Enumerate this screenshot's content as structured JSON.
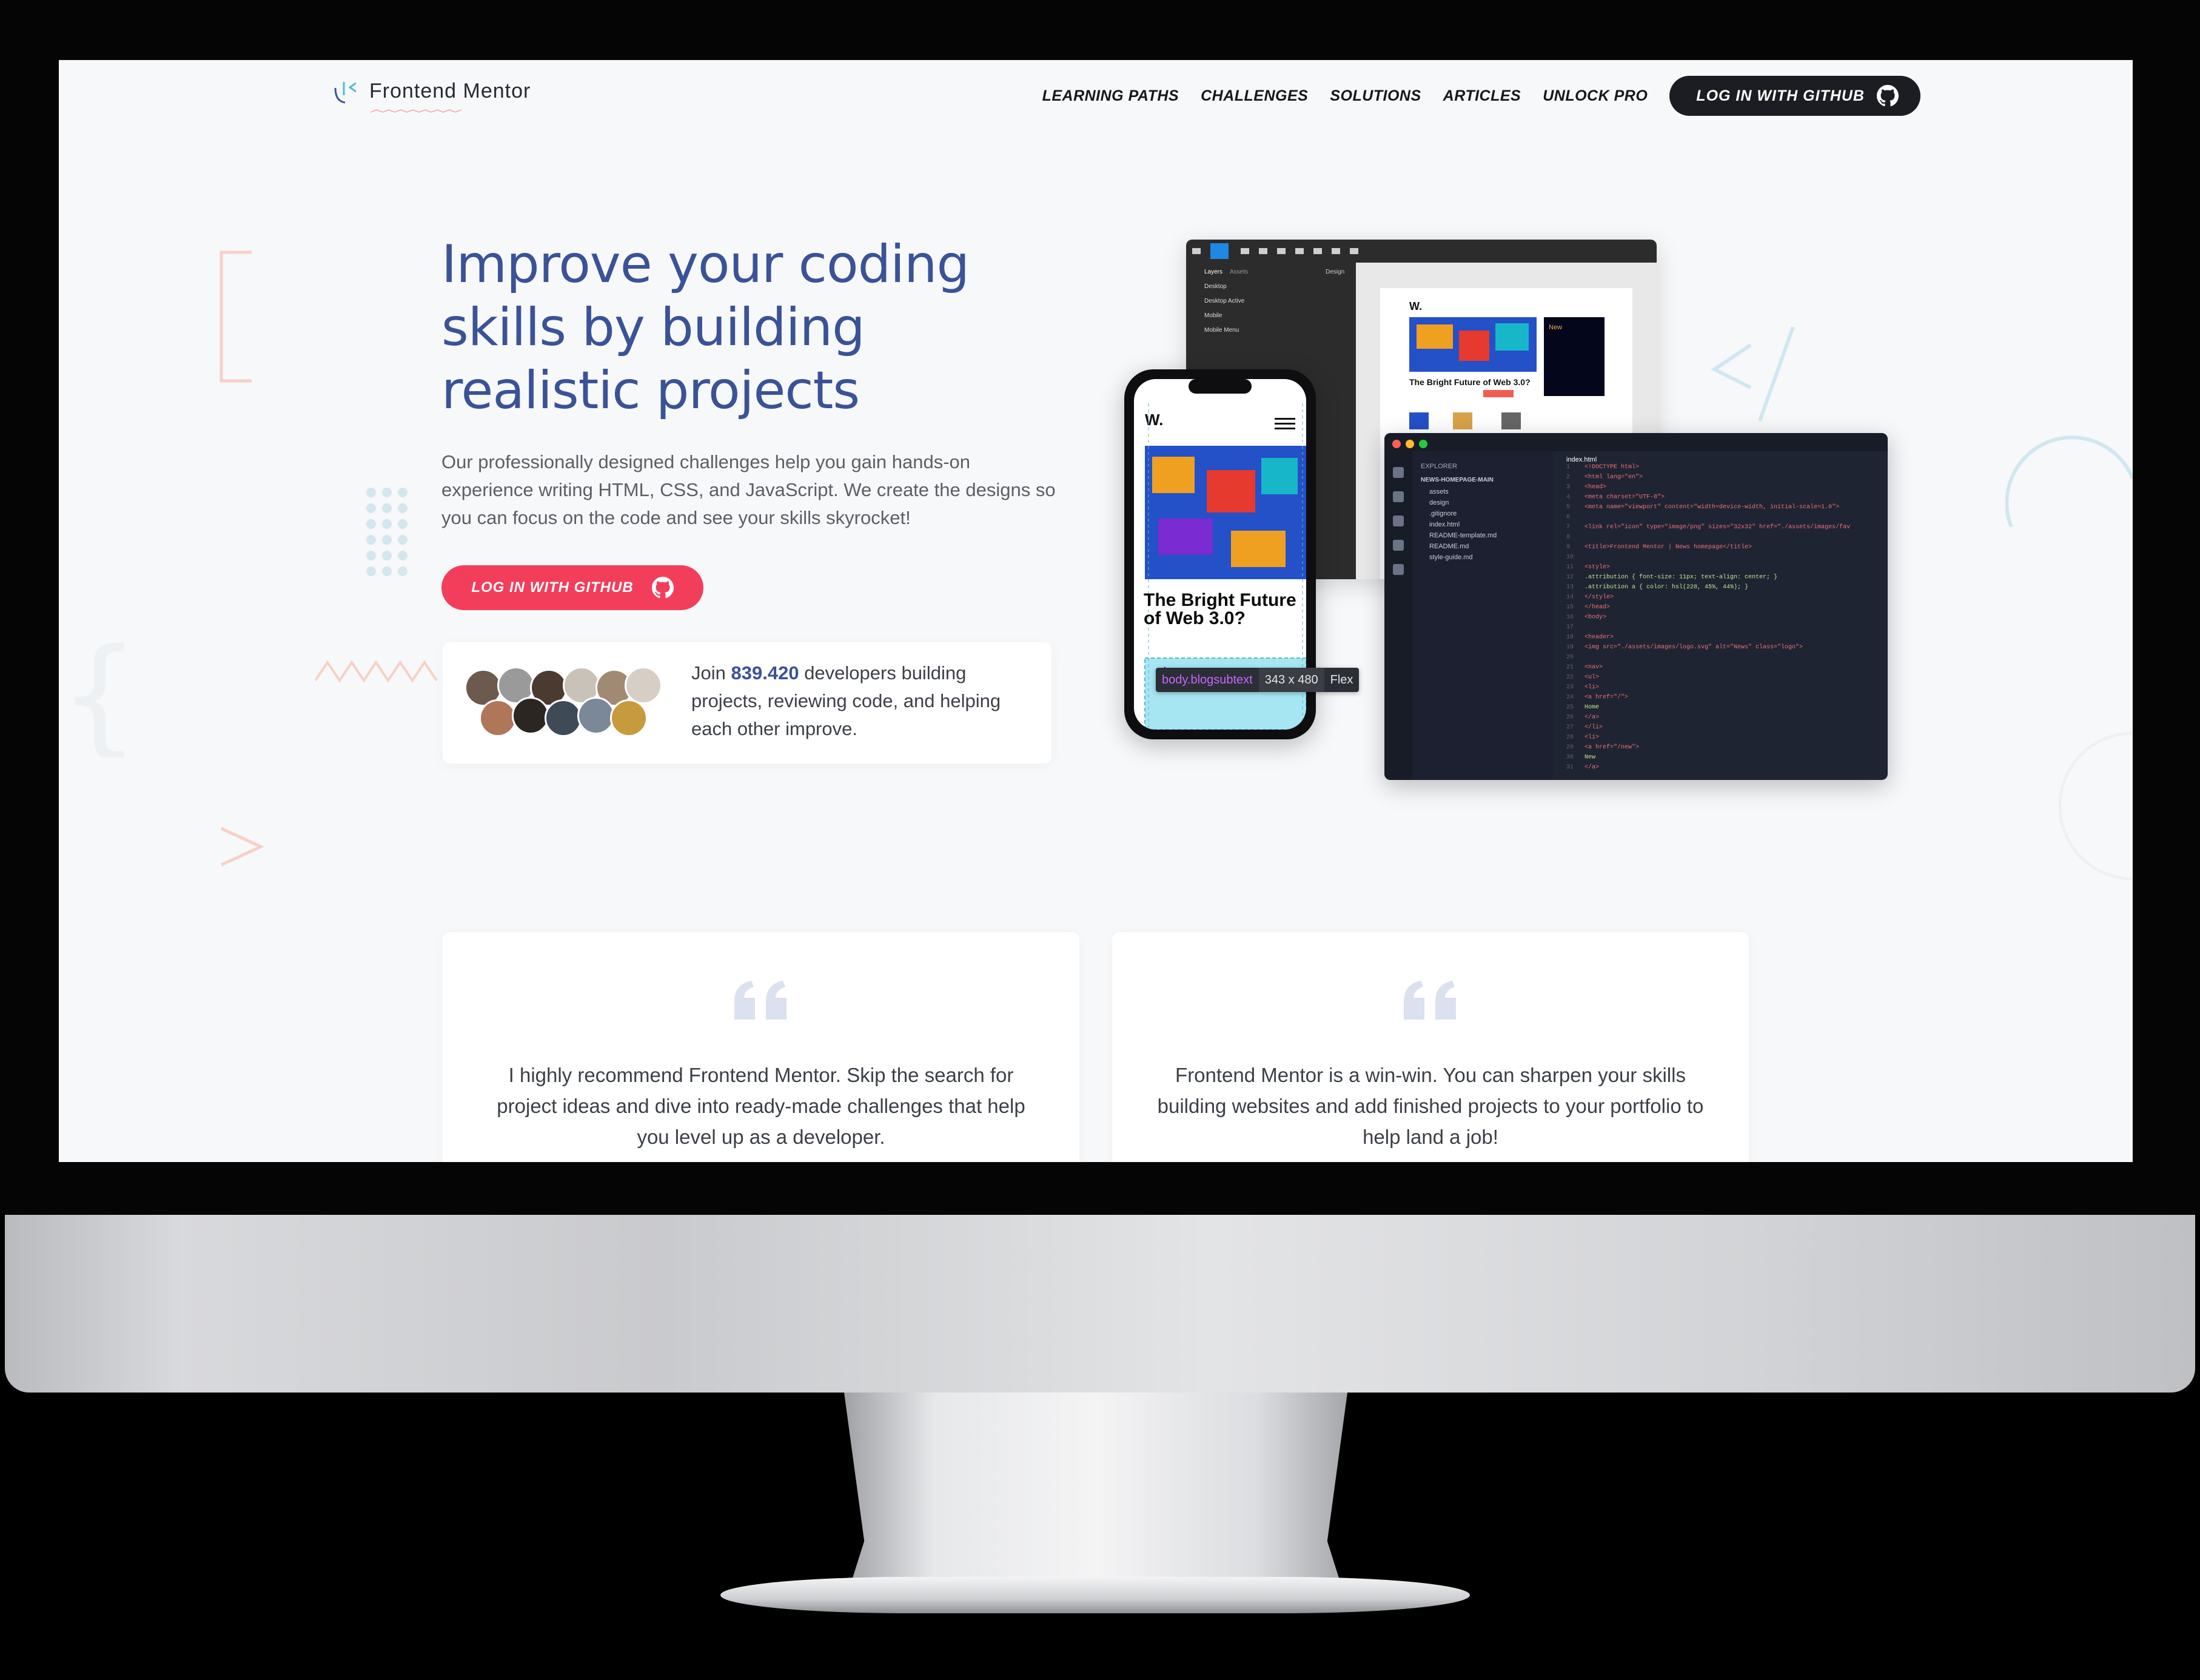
{
  "brand": {
    "name": "Frontend Mentor"
  },
  "nav": {
    "links": [
      "LEARNING PATHS",
      "CHALLENGES",
      "SOLUTIONS",
      "ARTICLES",
      "UNLOCK PRO"
    ],
    "login_label": "LOG IN WITH GITHUB"
  },
  "hero": {
    "title": "Improve your coding skills by building realistic projects",
    "description": "Our professionally designed challenges help you gain hands-on experience writing HTML, CSS, and JavaScript. We create the designs so you can focus on the code and see your skills skyrocket!",
    "cta_label": "LOG IN WITH GITHUB"
  },
  "community": {
    "prefix": "Join",
    "count": "839.420",
    "suffix": "developers building projects, reviewing code, and helping each other improve."
  },
  "mockup": {
    "phone_logo": "W.",
    "phone_headline": "The Bright Future of Web 3.0?",
    "inspector": {
      "selector": "body.blogsubtext",
      "size": "343 x 480",
      "layout": "Flex"
    },
    "design_logo": "W.",
    "design_headline": "The Bright Future of Web 3.0?",
    "design_side_title": "New",
    "layers": [
      "Desktop",
      "Desktop Active",
      "Mobile",
      "Mobile Menu"
    ],
    "layer_tabs": [
      "Layers",
      "Assets"
    ],
    "design_tab": "Design",
    "explorer_title": "EXPLORER",
    "explorer_folder": "NEWS-HOMEPAGE-MAIN",
    "explorer_files": [
      "assets",
      "design",
      ".gitignore",
      "index.html",
      "README-template.md",
      "README.md",
      "style-guide.md"
    ],
    "editor_tab": "index.html",
    "code_lines": [
      "<!DOCTYPE html>",
      "<html lang=\"en\">",
      "<head>",
      "  <meta charset=\"UTF-8\">",
      "  <meta name=\"viewport\" content=\"width=device-width, initial-scale=1.0\">",
      "",
      "  <link rel=\"icon\" type=\"image/png\" sizes=\"32x32\" href=\"./assets/images/fav",
      "",
      "  <title>Frontend Mentor | News homepage</title>",
      "",
      "  <style>",
      "    .attribution { font-size: 11px; text-align: center; }",
      "    .attribution a { color: hsl(228, 45%, 44%); }",
      "  </style>",
      "</head>",
      "<body>",
      "",
      "  <header>",
      "    <img src=\"./assets/images/logo.svg\" alt=\"News\" class=\"logo\">",
      "",
      "    <nav>",
      "      <ul>",
      "        <li>",
      "          <a href=\"/\">",
      "            Home",
      "          </a>",
      "        </li>",
      "        <li>",
      "          <a href=\"/new\">",
      "            New",
      "          </a>"
    ]
  },
  "testimonials": [
    {
      "text": "I highly recommend Frontend Mentor. Skip the search for project ideas and dive into ready-made challenges that help you level up as a developer."
    },
    {
      "text": "Frontend Mentor is a win-win. You can sharpen your skills building websites and add finished projects to your portfolio to help land a job!"
    }
  ],
  "colors": {
    "heading": "#3a5297",
    "accent_red": "#f33e5b",
    "dark_button": "#1b1d22",
    "code_bg": "#1f2433"
  },
  "icons": [
    "frontend-mentor-logo-icon",
    "github-icon",
    "quote-icon",
    "cursor-icon"
  ]
}
